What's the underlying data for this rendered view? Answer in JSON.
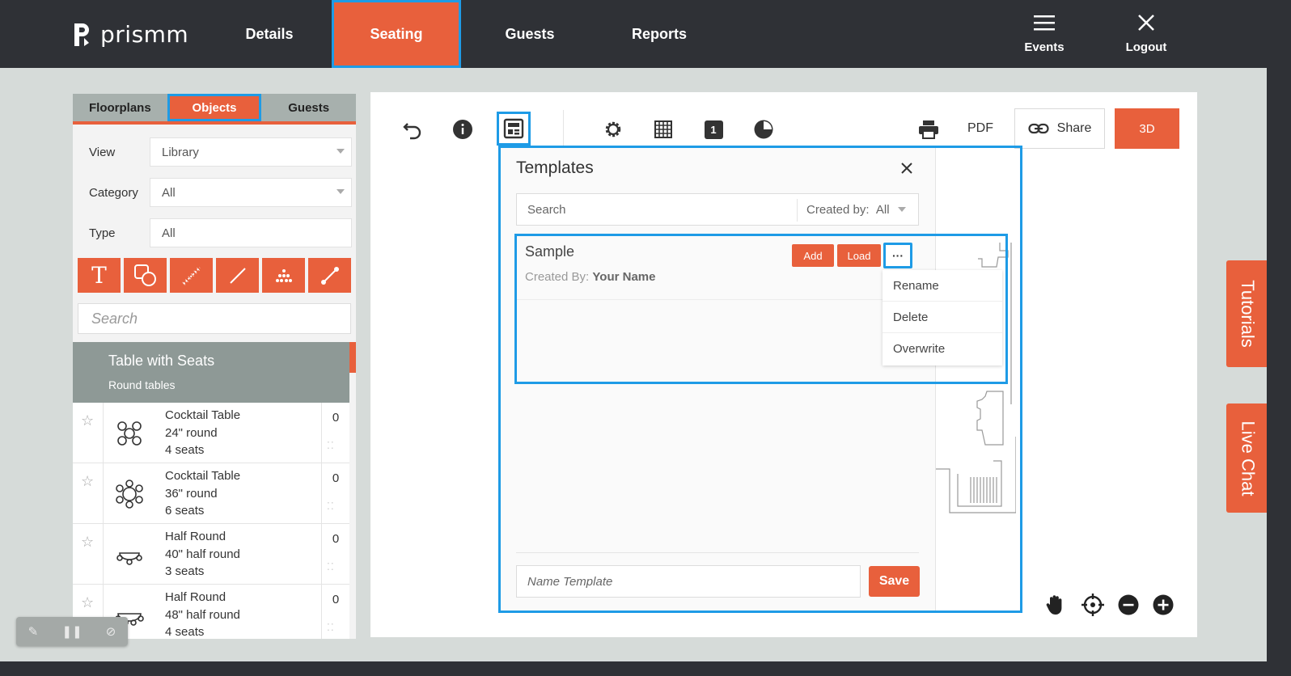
{
  "app": {
    "logo_text": "prismm"
  },
  "nav": {
    "items": [
      "Details",
      "Seating",
      "Guests",
      "Reports"
    ],
    "events_label": "Events",
    "logout_label": "Logout"
  },
  "left": {
    "tabs": [
      "Floorplans",
      "Objects",
      "Guests"
    ],
    "view_label": "View",
    "view_value": "Library",
    "category_label": "Category",
    "category_value": "All",
    "type_label": "Type",
    "type_value": "All",
    "search_placeholder": "Search",
    "category_title": "Table with Seats",
    "category_subtitle": "Round tables",
    "items": [
      {
        "l1": "Cocktail Table",
        "l2": "24\" round",
        "l3": "4 seats",
        "count": "0"
      },
      {
        "l1": "Cocktail Table",
        "l2": "36\" round",
        "l3": "6 seats",
        "count": "0"
      },
      {
        "l1": "Half Round",
        "l2": "40\" half round",
        "l3": "3 seats",
        "count": "0"
      },
      {
        "l1": "Half Round",
        "l2": "48\" half round",
        "l3": "4 seats",
        "count": "0"
      }
    ]
  },
  "toolbar": {
    "pdf_label": "PDF",
    "share_label": "Share",
    "btn3d_label": "3D",
    "page_number": "1"
  },
  "templates": {
    "title": "Templates",
    "search_placeholder": "Search",
    "created_by_label": "Created by:",
    "created_by_value": "All",
    "row": {
      "name": "Sample",
      "created_by_prefix": "Created By:",
      "created_by_name": "Your Name"
    },
    "add_label": "Add",
    "load_label": "Load",
    "more_label": "···",
    "menu": [
      "Rename",
      "Delete",
      "Overwrite"
    ],
    "name_placeholder": "Name Template",
    "save_label": "Save"
  },
  "side_tabs": {
    "tutorials": "Tutorials",
    "live_chat": "Live Chat"
  },
  "colors": {
    "accent": "#e8603c",
    "topbar": "#2f3136",
    "highlight": "#1e9be6",
    "background": "#d6dbd9"
  }
}
